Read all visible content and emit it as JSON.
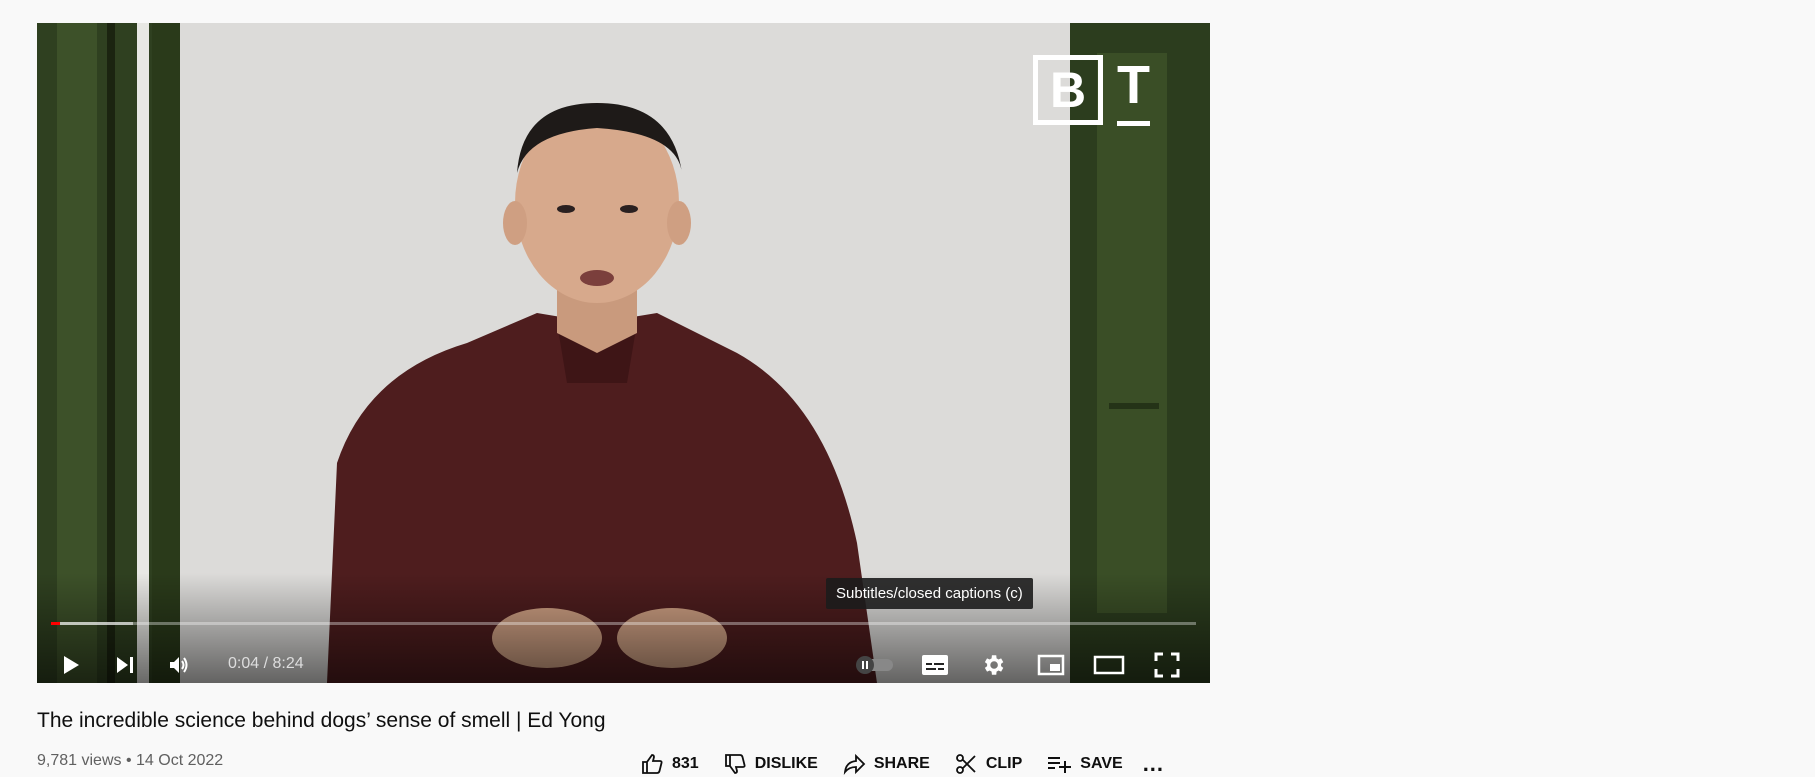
{
  "video": {
    "current_time": "0:04",
    "separator": "/",
    "duration": "8:24",
    "progress_fraction": 0.008,
    "buffered_fraction": 0.072,
    "tooltip": "Subtitles/closed captions (c)",
    "logo_letters": [
      "B",
      "T"
    ]
  },
  "info": {
    "title": "The incredible science behind dogs’ sense of smell | Ed Yong",
    "views": "9,781 views",
    "dot": "•",
    "date": "14 Oct 2022"
  },
  "actions": {
    "like_count": "831",
    "dislike_label": "DISLIKE",
    "share_label": "SHARE",
    "clip_label": "CLIP",
    "save_label": "SAVE",
    "more_label": "..."
  },
  "colors": {
    "progress_played": "#ff0000",
    "background": "#f9f9f9"
  },
  "icons": [
    "play-icon",
    "next-icon",
    "volume-icon",
    "autoplay-toggle-icon",
    "subtitles-icon",
    "settings-icon",
    "miniplayer-icon",
    "theater-mode-icon",
    "fullscreen-icon",
    "like-icon",
    "dislike-icon",
    "share-icon",
    "clip-icon",
    "save-icon",
    "more-icon"
  ]
}
